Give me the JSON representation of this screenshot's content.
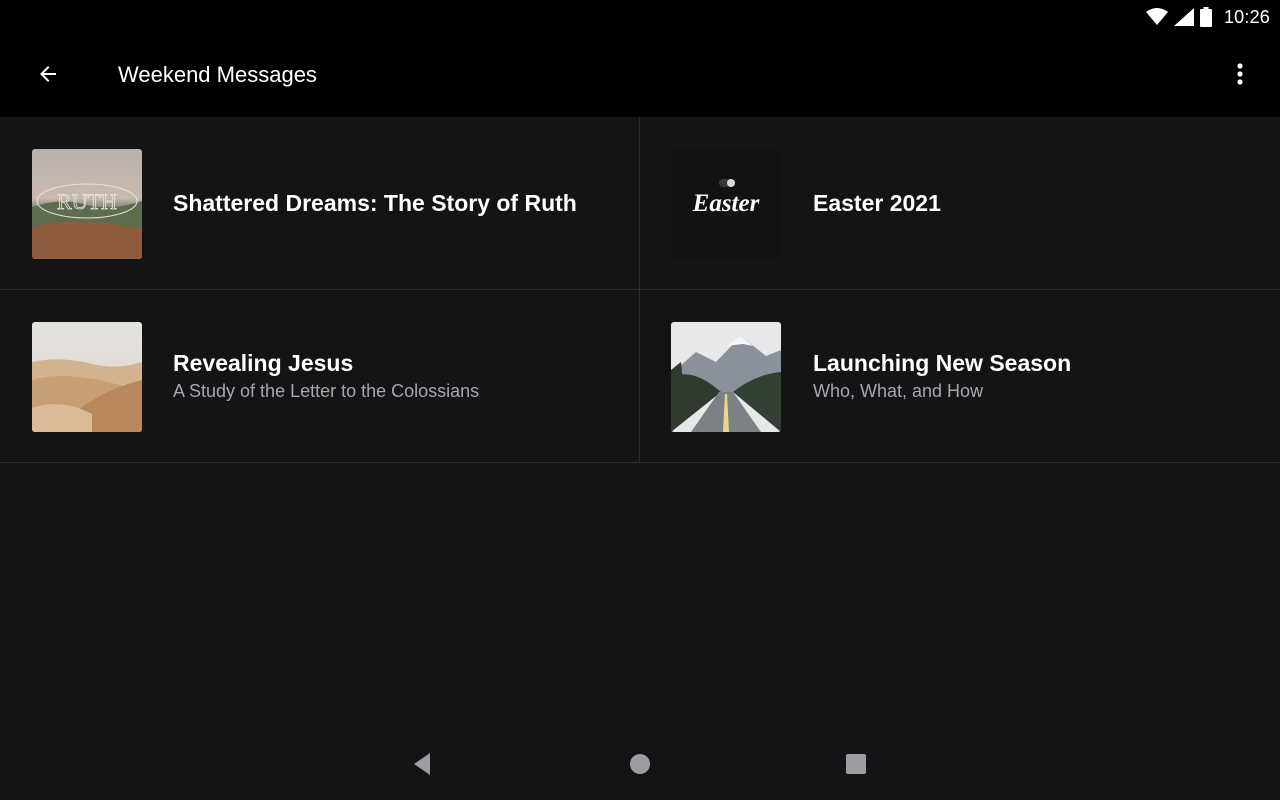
{
  "status_bar": {
    "time": "10:26",
    "icons": [
      "wifi-icon",
      "cell-signal-icon",
      "battery-icon"
    ]
  },
  "app_bar": {
    "title": "Weekend Messages",
    "back_icon": "arrow-back-icon",
    "menu_icon": "more-vert-icon"
  },
  "series": [
    {
      "title": "Shattered Dreams: The Story of Ruth",
      "subtitle": "",
      "thumb": "ruth-artwork",
      "thumb_text": "RUTH"
    },
    {
      "title": "Easter 2021",
      "subtitle": "",
      "thumb": "easter-artwork",
      "thumb_text": "Easter"
    },
    {
      "title": "Revealing Jesus",
      "subtitle": "A Study of the Letter to the Colossians",
      "thumb": "desert-dunes-photo"
    },
    {
      "title": "Launching New Season",
      "subtitle": "Who, What, and How",
      "thumb": "mountain-road-photo"
    }
  ],
  "nav_bar": {
    "back": "nav-back-icon",
    "home": "nav-home-icon",
    "recents": "nav-recents-icon"
  },
  "colors": {
    "background": "#141416",
    "bar": "#000000",
    "divider": "#2c2c2f",
    "subtitle": "#a8a8ac"
  }
}
